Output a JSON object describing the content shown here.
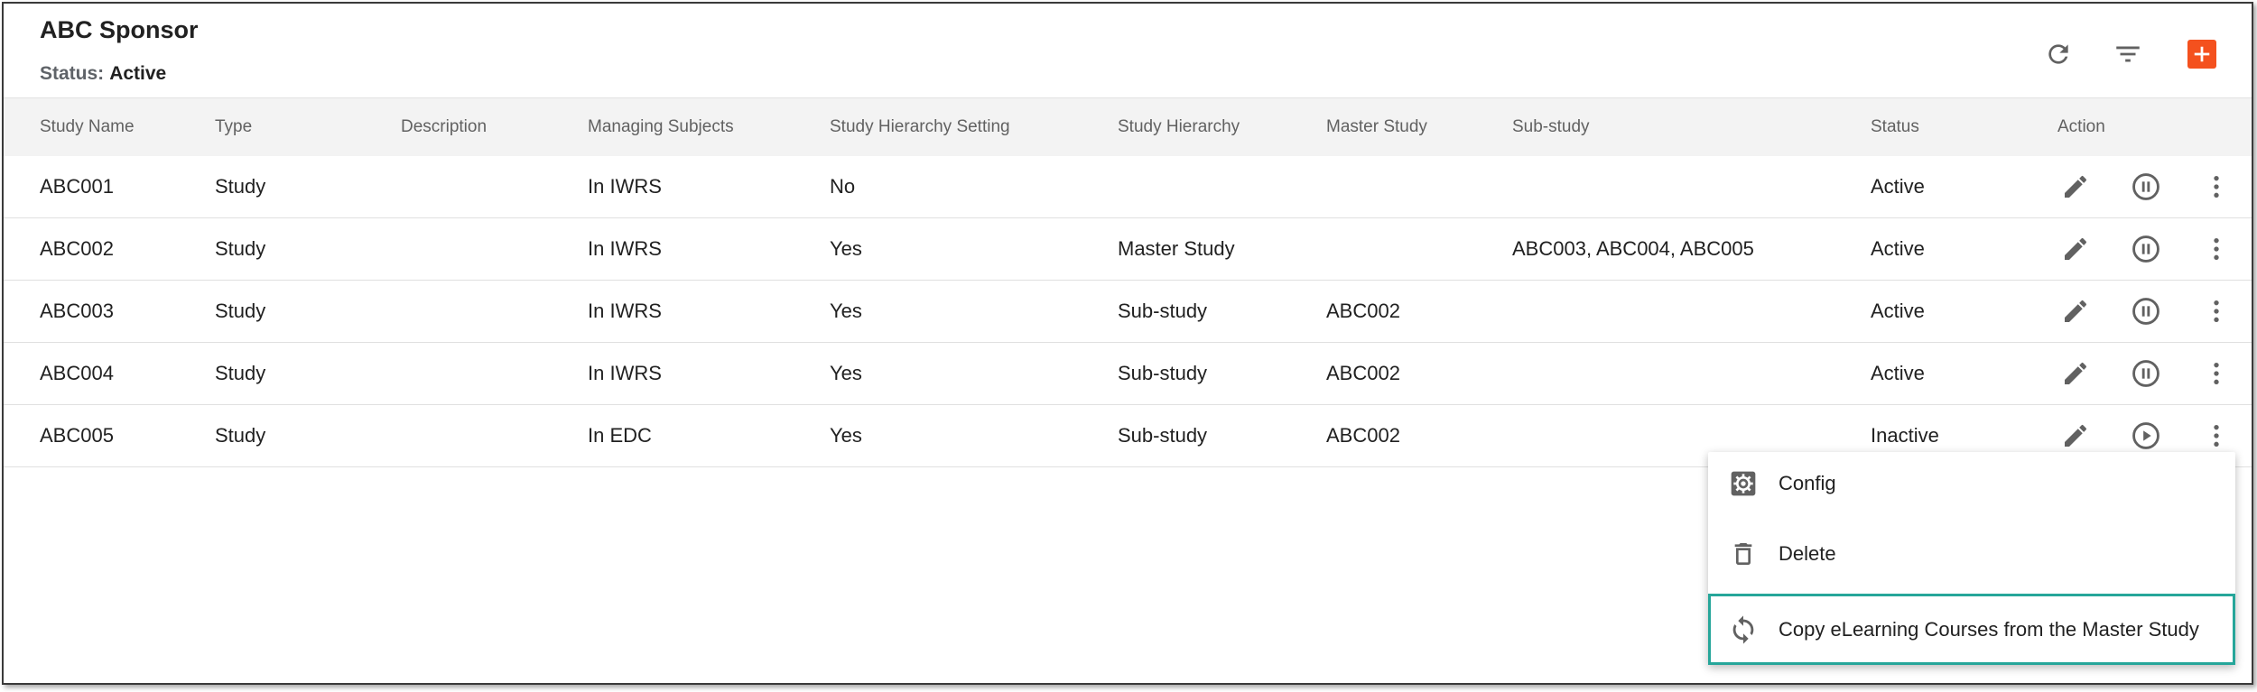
{
  "header": {
    "title": "ABC Sponsor",
    "status_label": "Status:",
    "status_value": "Active",
    "toolbar": {
      "refresh_icon": "refresh-icon",
      "filter_icon": "filter-icon",
      "add_icon": "add-icon",
      "add_color": "#f4511e"
    }
  },
  "table": {
    "columns": [
      "Study Name",
      "Type",
      "Description",
      "Managing Subjects",
      "Study Hierarchy Setting",
      "Study Hierarchy",
      "Master Study",
      "Sub-study",
      "Status",
      "Action"
    ],
    "rows": [
      {
        "name": "ABC001",
        "type": "Study",
        "description": "",
        "managing": "In IWRS",
        "setting": "No",
        "hierarchy": "",
        "master": "",
        "sub": "",
        "status": "Active",
        "toggle_icon": "pause-icon"
      },
      {
        "name": "ABC002",
        "type": "Study",
        "description": "",
        "managing": "In IWRS",
        "setting": "Yes",
        "hierarchy": "Master Study",
        "master": "",
        "sub": "ABC003, ABC004, ABC005",
        "status": "Active",
        "toggle_icon": "pause-icon"
      },
      {
        "name": "ABC003",
        "type": "Study",
        "description": "",
        "managing": "In IWRS",
        "setting": "Yes",
        "hierarchy": "Sub-study",
        "master": "ABC002",
        "sub": "",
        "status": "Active",
        "toggle_icon": "pause-icon"
      },
      {
        "name": "ABC004",
        "type": "Study",
        "description": "",
        "managing": "In IWRS",
        "setting": "Yes",
        "hierarchy": "Sub-study",
        "master": "ABC002",
        "sub": "",
        "status": "Active",
        "toggle_icon": "pause-icon"
      },
      {
        "name": "ABC005",
        "type": "Study",
        "description": "",
        "managing": "In EDC",
        "setting": "Yes",
        "hierarchy": "Sub-study",
        "master": "ABC002",
        "sub": "",
        "status": "Inactive",
        "toggle_icon": "play-icon"
      }
    ]
  },
  "context_menu": {
    "items": [
      {
        "label": "Config",
        "icon": "gear-icon"
      },
      {
        "label": "Delete",
        "icon": "trash-icon"
      },
      {
        "label": "Copy eLearning Courses from the Master Study",
        "icon": "sync-icon",
        "highlighted": true
      }
    ],
    "highlight_color": "#26a69a"
  }
}
